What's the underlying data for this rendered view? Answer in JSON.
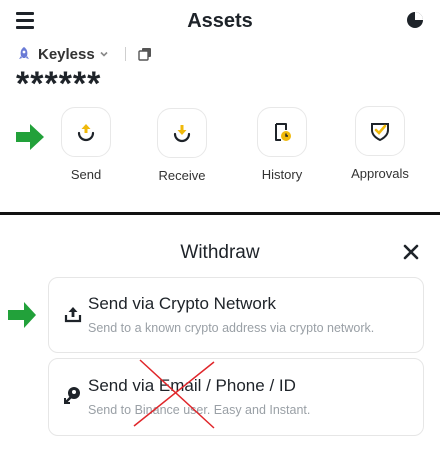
{
  "header": {
    "title": "Assets"
  },
  "account": {
    "name": "Keyless",
    "balance_masked": "******"
  },
  "actions": [
    {
      "label": "Send",
      "icon": "upload-circle-icon"
    },
    {
      "label": "Receive",
      "icon": "download-circle-icon"
    },
    {
      "label": "History",
      "icon": "history-clock-icon"
    },
    {
      "label": "Approvals",
      "icon": "shield-check-icon"
    }
  ],
  "withdraw": {
    "title": "Withdraw",
    "options": [
      {
        "title": "Send via Crypto Network",
        "description": "Send to a known crypto address via crypto network.",
        "icon": "upload-icon"
      },
      {
        "title": "Send via Email / Phone / ID",
        "description": "Send to Binance user. Easy and Instant.",
        "icon": "user-send-icon"
      }
    ]
  },
  "colors": {
    "accent": "#f0b90b",
    "annotation_green": "#22a13a",
    "cross_red": "#e0262a",
    "text": "#1e2329",
    "muted": "#9aa0a6"
  }
}
